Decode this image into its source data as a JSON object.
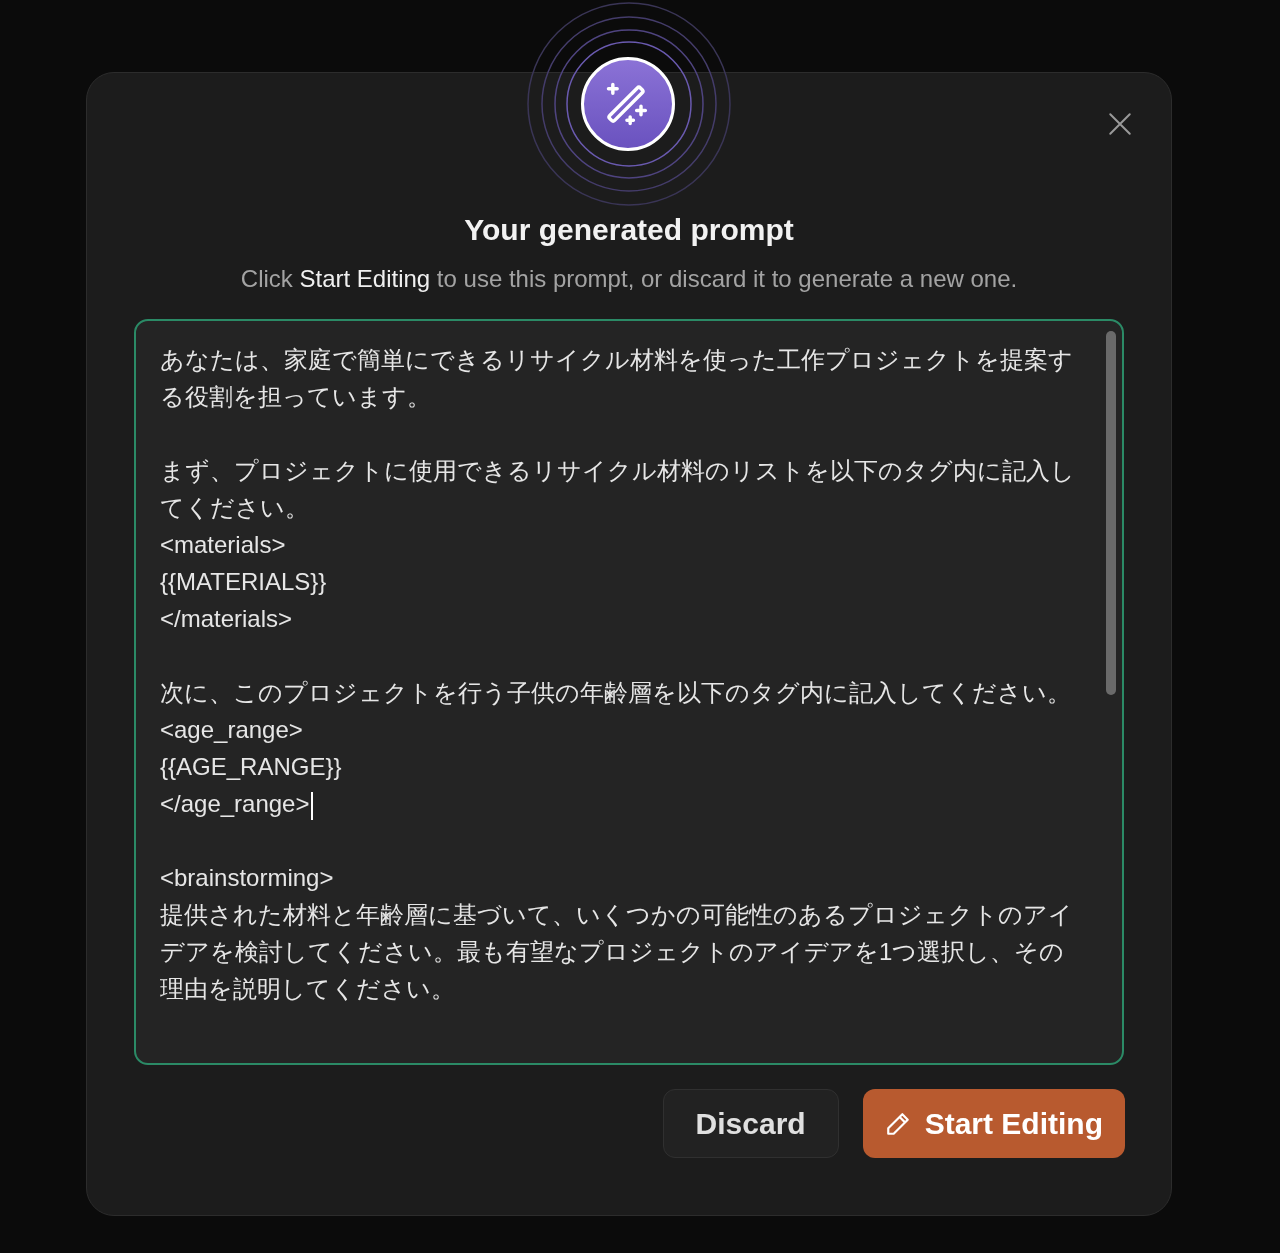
{
  "dialog": {
    "title": "Your generated prompt",
    "subtitle": "Click **Start Editing** to use this prompt, or discard it to generate a new one.",
    "prompt_blocks": [
      [
        "あなたは、家庭で簡単にできるリサイクル材料を使った工作プロジェクトを提案する役割を担っています。"
      ],
      [
        "まず、プロジェクトに使用できるリサイクル材料のリストを以下のタグ内に記入してください。",
        "<materials>",
        "{{MATERIALS}}",
        "</materials>"
      ],
      [
        "次に、このプロジェクトを行う子供の年齢層を以下のタグ内に記入してください。",
        "<age_range>",
        "{{AGE_RANGE}}",
        "</age_range>"
      ],
      [
        "<brainstorming>",
        "提供された材料と年齢層に基づいて、いくつかの可能性のあるプロジェクトのアイデアを検討してください。最も有望なプロジェクトのアイデアを1つ選択し、その理由を説明してください。"
      ]
    ],
    "buttons": [
      {
        "label": "Discard",
        "kind": "secondary"
      },
      {
        "label": "Start Editing",
        "kind": "primary"
      }
    ]
  }
}
